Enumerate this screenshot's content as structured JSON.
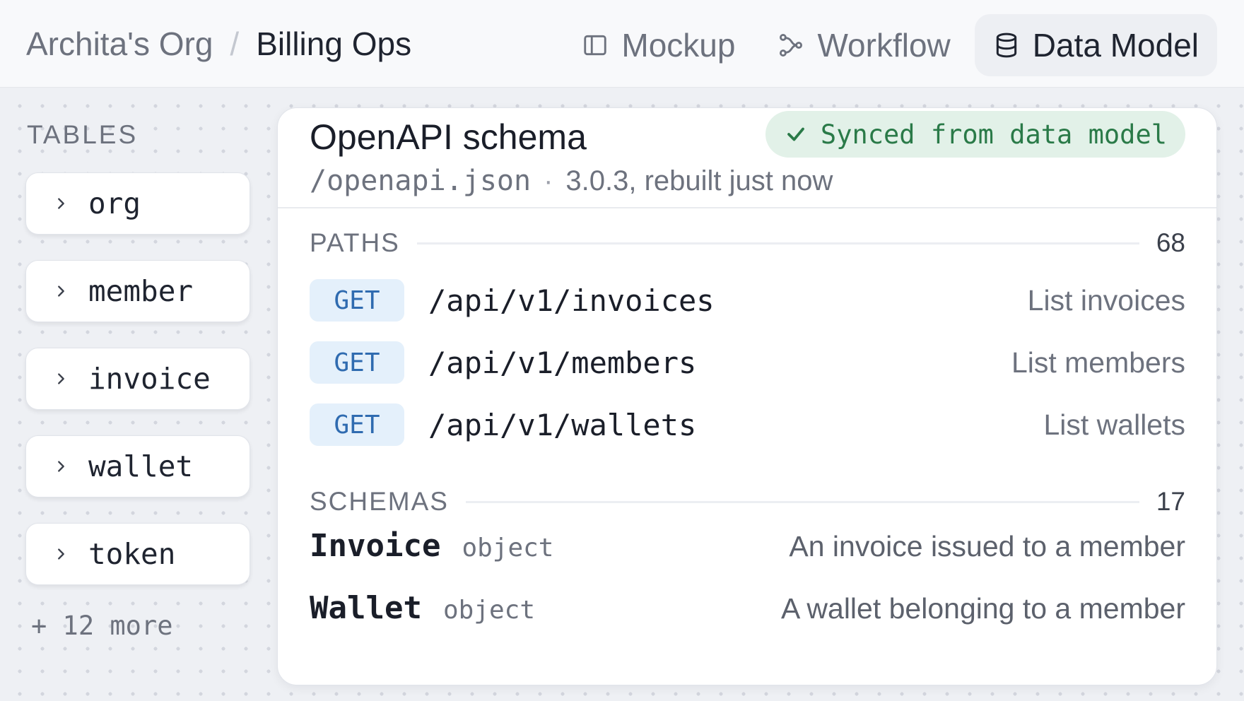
{
  "header": {
    "breadcrumb": {
      "org": "Archita's Org",
      "separator": "/",
      "current": "Billing Ops"
    },
    "nav": [
      {
        "label": "Mockup",
        "icon": "panel-icon",
        "active": false
      },
      {
        "label": "Workflow",
        "icon": "workflow-icon",
        "active": false
      },
      {
        "label": "Data Model",
        "icon": "database-icon",
        "active": true
      }
    ]
  },
  "sidebar": {
    "title": "TABLES",
    "items": [
      {
        "label": "org"
      },
      {
        "label": "member"
      },
      {
        "label": "invoice"
      },
      {
        "label": "wallet"
      },
      {
        "label": "token"
      }
    ],
    "more": "+ 12 more"
  },
  "panel": {
    "title": "OpenAPI schema",
    "badge": "Synced from data model",
    "file": "/openapi.json",
    "separator": "·",
    "version_info": "3.0.3, rebuilt just now",
    "paths": {
      "label": "PATHS",
      "count": "68",
      "rows": [
        {
          "method": "GET",
          "path": "/api/v1/invoices",
          "desc": "List invoices"
        },
        {
          "method": "GET",
          "path": "/api/v1/members",
          "desc": "List members"
        },
        {
          "method": "GET",
          "path": "/api/v1/wallets",
          "desc": "List wallets"
        }
      ]
    },
    "schemas": {
      "label": "SCHEMAS",
      "count": "17",
      "rows": [
        {
          "name": "Invoice",
          "type": "object",
          "desc": "An invoice issued to a member"
        },
        {
          "name": "Wallet",
          "type": "object",
          "desc": "A wallet belonging to a member"
        }
      ]
    }
  },
  "colors": {
    "accent_green": "#2a7a48",
    "badge_green_bg": "#e2f1e8",
    "method_blue": "#2f6bb0",
    "method_blue_bg": "#e4f0fb"
  }
}
